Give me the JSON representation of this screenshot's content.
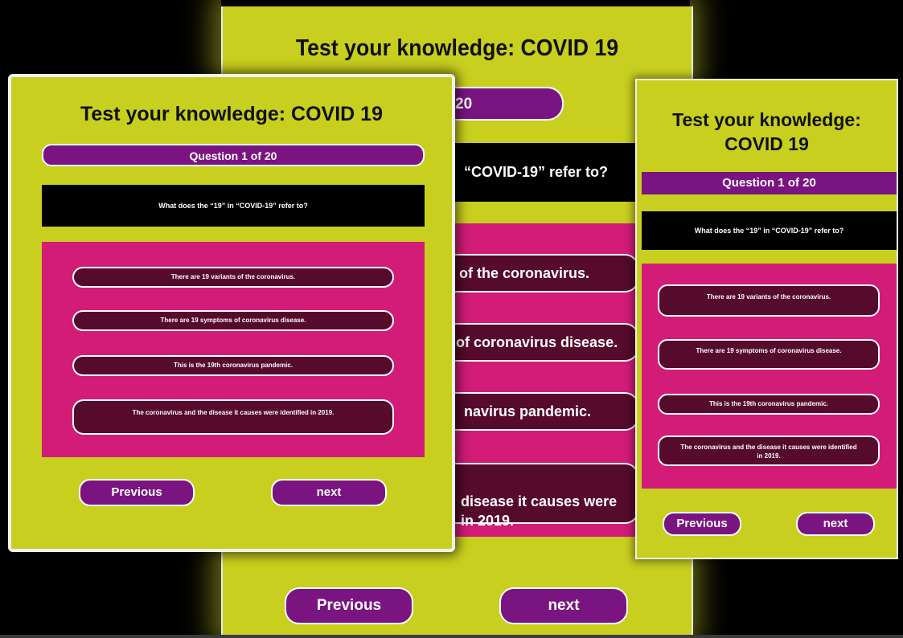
{
  "title": "Test your knowledge: COVID 19",
  "question_counter": "Question 1 of 20",
  "question": "What does the “19” in “COVID-19” refer to?",
  "options": [
    "There are 19 variants of the coronavirus.",
    "There are 19 symptoms of coronavirus disease.",
    "This is the 19th coronavirus pandemic.",
    "The coronavirus and the disease it causes were identified in 2019."
  ],
  "previous_label": "Previous",
  "next_label": "next",
  "back_view": {
    "counter_visible": "1 of 20",
    "question_visible": "“COVID-19” refer to?",
    "options_visible": [
      "of the coronavirus.",
      "of coronavirus disease.",
      "navirus pandemic.",
      "disease it causes were\nin 2019."
    ]
  },
  "colors": {
    "background": "#000000",
    "lime": "#c8cf1e",
    "purple": "#7a1480",
    "magenta": "#d21c78",
    "maroon": "#560a2c",
    "question_bg": "#000000"
  }
}
